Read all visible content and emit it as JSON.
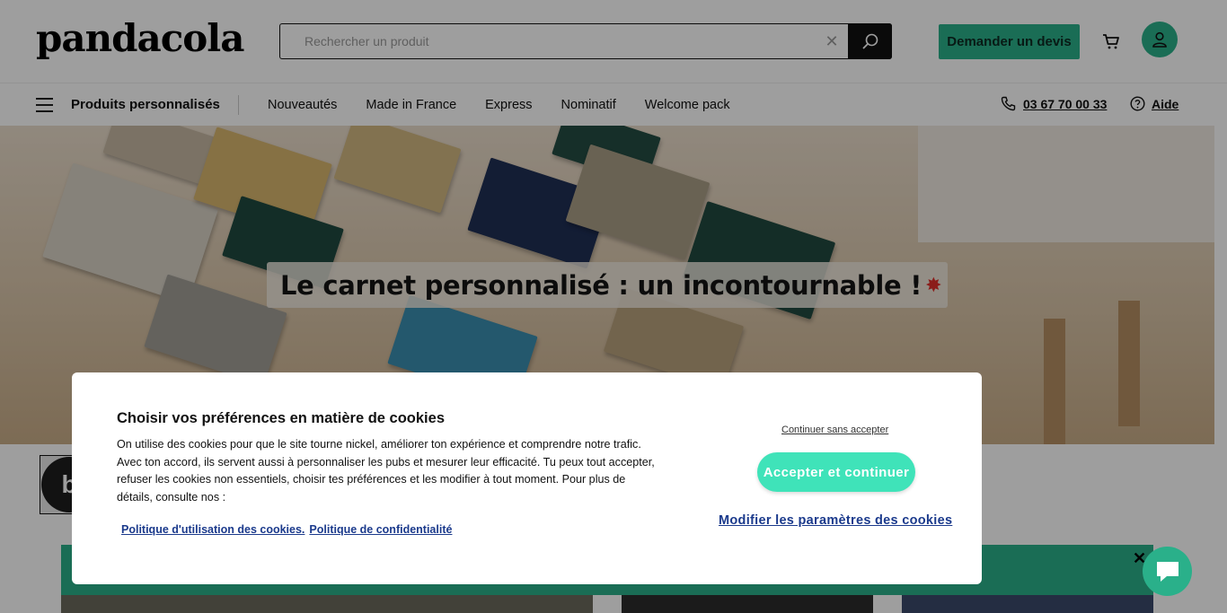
{
  "header": {
    "logo": "pandacola",
    "search": {
      "placeholder": "Rechercher un produit"
    },
    "quote_button": "Demander un devis"
  },
  "nav": {
    "main_label": "Produits personnalisés",
    "links": [
      "Nouveautés",
      "Made in France",
      "Express",
      "Nominatif",
      "Welcome pack"
    ],
    "phone": "03 67 70 00 33",
    "help": "Aide"
  },
  "hero": {
    "title": "Le carnet personnalisé :  un incontournable !"
  },
  "cookie": {
    "title": "Choisir vos préférences en matière de cookies",
    "body": "On utilise des cookies pour que le site tourne nickel, améliorer ton expérience et comprendre notre trafic. Avec ton accord, ils servent aussi à personnaliser les pubs et mesurer leur efficacité. Tu peux tout accepter, refuser les cookies non essentiels, choisir tes préférences et les modifier à tout moment. Pour plus de détails, consulte nos :",
    "link_cookies": "Politique d'utilisation des cookies.",
    "link_privacy": "Politique de confidentialité",
    "continue_label": "Continuer sans accepter",
    "accept_label": "Accepter et continuer",
    "modify_label": "Modifier les paramètres des cookies"
  },
  "colors": {
    "accent": "#2ab08a",
    "accept": "#3fe3b9",
    "link": "#1b3a8c"
  },
  "icons": {
    "search": "search-icon",
    "clear": "close-icon",
    "cart": "cart-icon",
    "account": "user-icon",
    "menu": "hamburger-icon",
    "phone": "phone-icon",
    "help": "help-icon",
    "chat": "chat-icon",
    "promo_close": "close-icon"
  }
}
